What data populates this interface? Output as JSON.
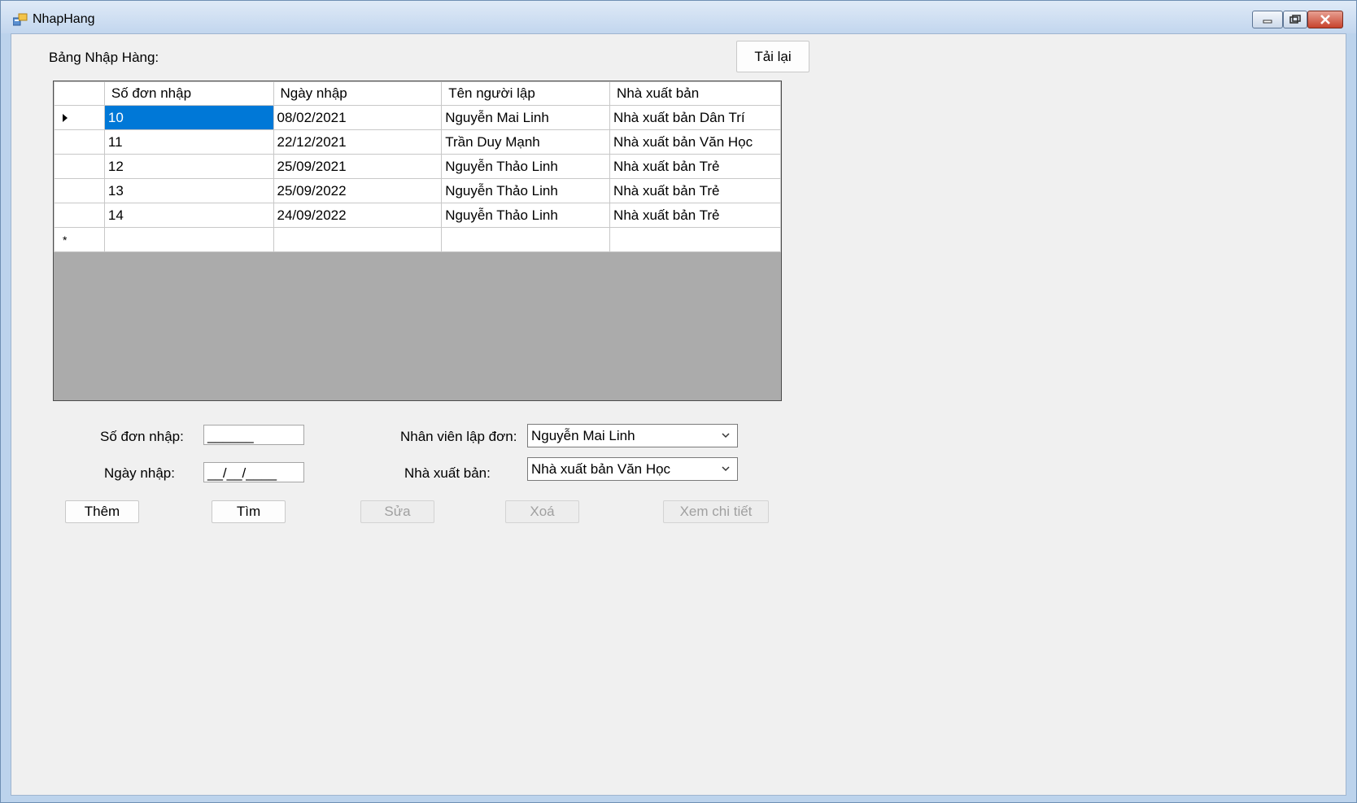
{
  "window": {
    "title": "NhapHang"
  },
  "header": {
    "table_label": "Bảng Nhập Hàng:",
    "reload_button": "Tải lại"
  },
  "table": {
    "columns": [
      "Số đơn nhập",
      "Ngày nhập",
      "Tên người lập",
      "Nhà xuất bản"
    ],
    "rows": [
      [
        "10",
        "08/02/2021",
        "Nguyễn Mai Linh",
        "Nhà xuất bản Dân Trí"
      ],
      [
        "11",
        "22/12/2021",
        "Trần Duy Mạnh",
        "Nhà xuất bản Văn Học"
      ],
      [
        "12",
        "25/09/2021",
        "Nguyễn Thảo Linh",
        "Nhà xuất bản Trẻ"
      ],
      [
        "13",
        "25/09/2022",
        "Nguyễn Thảo Linh",
        "Nhà xuất bản Trẻ"
      ],
      [
        "14",
        "24/09/2022",
        "Nguyễn Thảo Linh",
        "Nhà xuất bản Trẻ"
      ]
    ],
    "new_row_marker": "*"
  },
  "form": {
    "order_no_label": "Số đơn nhập:",
    "order_no_value": "______",
    "date_label": "Ngày nhập:",
    "date_value": "__/__/____",
    "staff_label": "Nhân viên lập đơn:",
    "staff_value": "Nguyễn Mai Linh",
    "publisher_label": "Nhà xuất bản:",
    "publisher_value": "Nhà xuất bản Văn Học"
  },
  "actions": {
    "add": "Thêm",
    "find": "Tìm",
    "edit": "Sửa",
    "delete": "Xoá",
    "details": "Xem chi tiết"
  },
  "colors": {
    "selection": "#0078d7",
    "grid_background": "#ababab",
    "form_background": "#f0f0f0"
  },
  "icons": [
    "app-icon",
    "minimize-icon",
    "maximize-icon",
    "close-icon",
    "row-pointer-icon",
    "chevron-down-icon"
  ]
}
